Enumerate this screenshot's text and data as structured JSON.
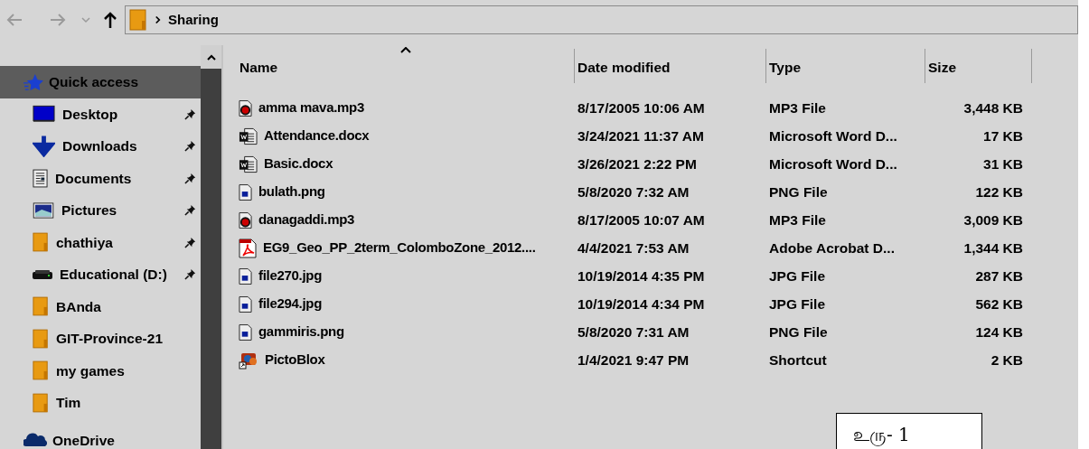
{
  "address": {
    "path": [
      "Sharing"
    ]
  },
  "sidebar": {
    "items": [
      {
        "label": "Quick access",
        "kind": "quick",
        "pinned": false,
        "selected": true
      },
      {
        "label": "Desktop",
        "kind": "desktop",
        "pinned": true,
        "selected": false
      },
      {
        "label": "Downloads",
        "kind": "downloads",
        "pinned": true,
        "selected": false
      },
      {
        "label": "Documents",
        "kind": "documents",
        "pinned": true,
        "selected": false
      },
      {
        "label": "Pictures",
        "kind": "pictures",
        "pinned": true,
        "selected": false
      },
      {
        "label": "chathiya",
        "kind": "folder",
        "pinned": true,
        "selected": false
      },
      {
        "label": "Educational (D:)",
        "kind": "drive",
        "pinned": true,
        "selected": false
      },
      {
        "label": "BAnda",
        "kind": "folder",
        "pinned": false,
        "selected": false
      },
      {
        "label": "GIT-Province-21",
        "kind": "folder",
        "pinned": false,
        "selected": false
      },
      {
        "label": "my games",
        "kind": "folder",
        "pinned": false,
        "selected": false
      },
      {
        "label": "Tim",
        "kind": "folder",
        "pinned": false,
        "selected": false
      },
      {
        "label": "OneDrive",
        "kind": "cloud",
        "pinned": false,
        "selected": false
      }
    ]
  },
  "table": {
    "columns": [
      {
        "label": "Name",
        "sorted": true
      },
      {
        "label": "Date modified",
        "sorted": false
      },
      {
        "label": "Type",
        "sorted": false
      },
      {
        "label": "Size",
        "sorted": false
      }
    ],
    "rows": [
      {
        "kind": "audio",
        "name": "amma mava.mp3",
        "date": "8/17/2005 10:06 AM",
        "type": "MP3 File",
        "size": "3,448 KB"
      },
      {
        "kind": "word",
        "name": "Attendance.docx",
        "date": "3/24/2021 11:37 AM",
        "type": "Microsoft Word D...",
        "size": "17 KB"
      },
      {
        "kind": "word",
        "name": "Basic.docx",
        "date": "3/26/2021 2:22 PM",
        "type": "Microsoft Word D...",
        "size": "31 KB"
      },
      {
        "kind": "image",
        "name": "bulath.png",
        "date": "5/8/2020 7:32 AM",
        "type": "PNG File",
        "size": "122 KB"
      },
      {
        "kind": "audio",
        "name": "danagaddi.mp3",
        "date": "8/17/2005 10:07 AM",
        "type": "MP3 File",
        "size": "3,009 KB"
      },
      {
        "kind": "pdf",
        "name": "EG9_Geo_PP_2term_ColomboZone_2012....",
        "date": "4/4/2021 7:53 AM",
        "type": "Adobe Acrobat D...",
        "size": "1,344 KB"
      },
      {
        "kind": "image",
        "name": "file270.jpg",
        "date": "10/19/2014 4:35 PM",
        "type": "JPG File",
        "size": "287 KB"
      },
      {
        "kind": "image",
        "name": "file294.jpg",
        "date": "10/19/2014 4:34 PM",
        "type": "JPG File",
        "size": "562 KB"
      },
      {
        "kind": "image",
        "name": "gammiris.png",
        "date": "5/8/2020 7:31 AM",
        "type": "PNG File",
        "size": "124 KB"
      },
      {
        "kind": "shortcut",
        "name": "PictoBlox",
        "date": "1/4/2021 9:47 PM",
        "type": "Shortcut",
        "size": "2 KB"
      }
    ]
  },
  "caption": "உரு- 1"
}
